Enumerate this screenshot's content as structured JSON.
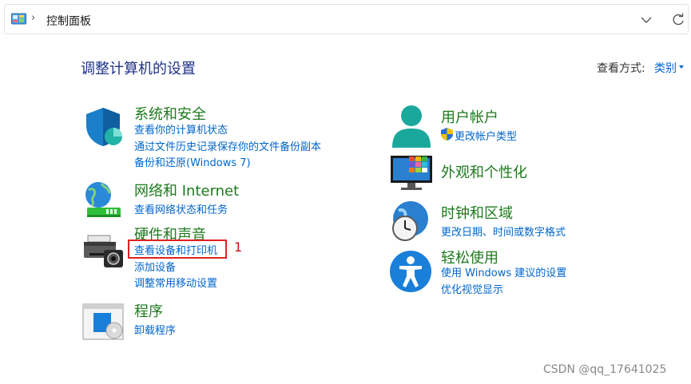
{
  "address_bar": {
    "breadcrumb": "控制面板"
  },
  "header": {
    "title": "调整计算机的设置",
    "view_by_label": "查看方式:",
    "view_by_value": "类别"
  },
  "categories": {
    "system_security": {
      "title": "系统和安全",
      "links": [
        "查看你的计算机状态",
        "通过文件历史记录保存你的文件备份副本",
        "备份和还原(Windows 7)"
      ]
    },
    "network": {
      "title": "网络和 Internet",
      "links": [
        "查看网络状态和任务"
      ]
    },
    "hardware": {
      "title": "硬件和声音",
      "links": [
        "查看设备和打印机",
        "添加设备",
        "调整常用移动设置"
      ]
    },
    "programs": {
      "title": "程序",
      "links": [
        "卸载程序"
      ]
    },
    "user_accounts": {
      "title": "用户帐户",
      "links": [
        "更改帐户类型"
      ]
    },
    "appearance": {
      "title": "外观和个性化"
    },
    "clock_region": {
      "title": "时钟和区域",
      "links": [
        "更改日期、时间或数字格式"
      ]
    },
    "ease_of_access": {
      "title": "轻松使用",
      "links": [
        "使用 Windows 建议的设置",
        "优化视觉显示"
      ]
    }
  },
  "annotation": {
    "number": "1"
  },
  "watermark": "CSDN @qq_17641025",
  "colors": {
    "title_blue": "#1e3287",
    "category_green": "#1d7a1d",
    "link_blue": "#0066cc",
    "highlight_red": "#e02020"
  }
}
